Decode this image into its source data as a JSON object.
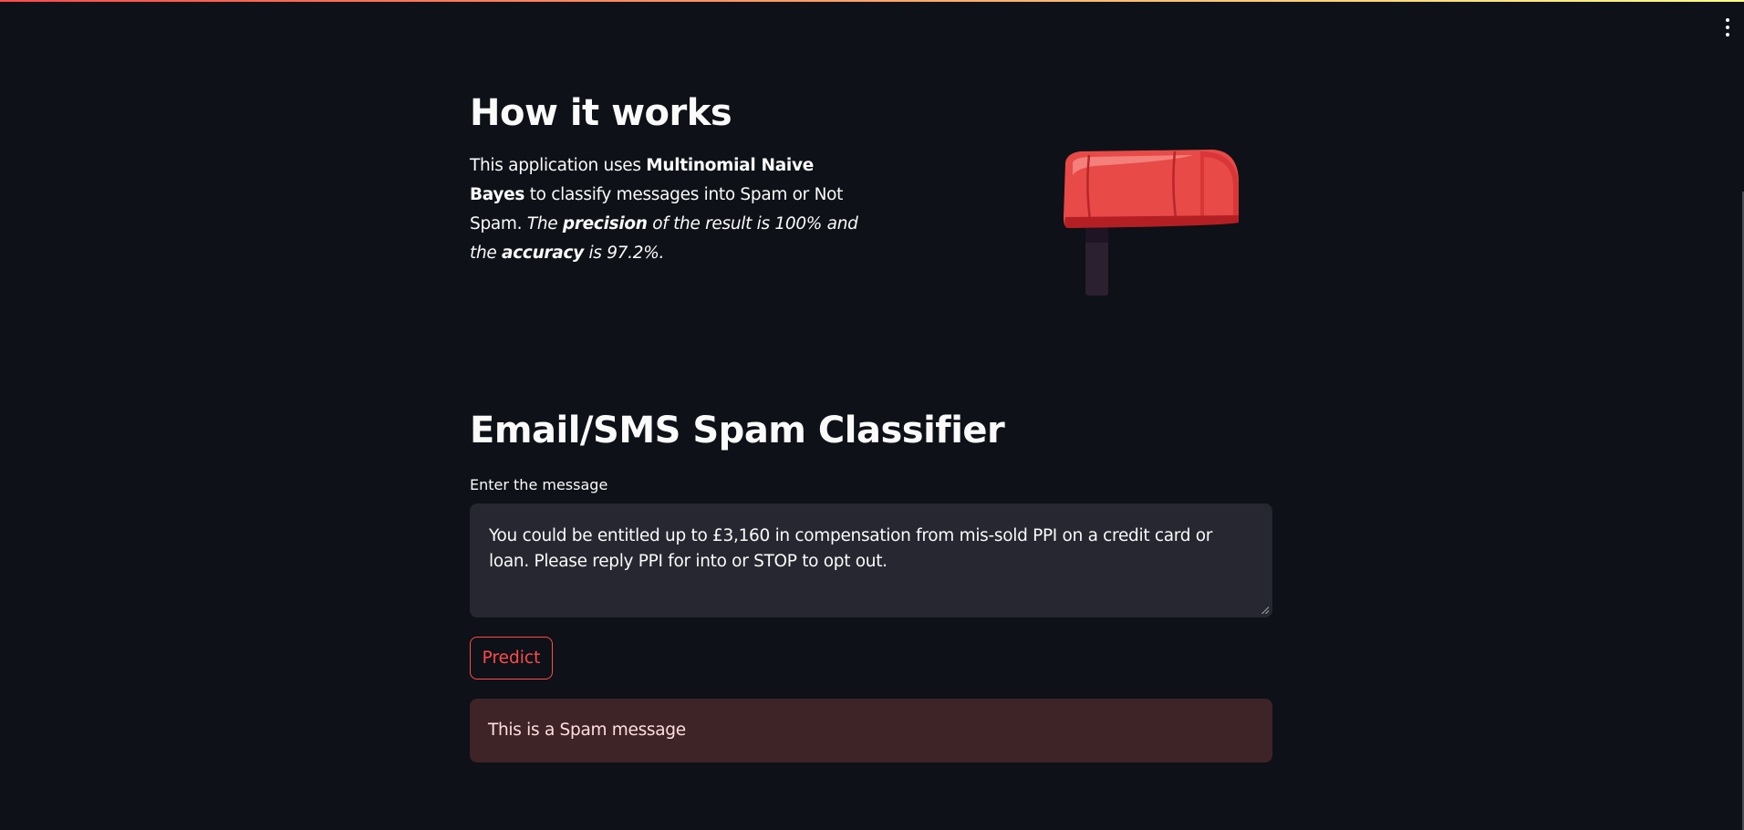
{
  "about": {
    "title": "How it works",
    "body": {
      "text1": "This application uses ",
      "bold1": "Multinomial Naive Bayes",
      "text2": " to classify messages into Spam or Not Spam. ",
      "italic1": "The ",
      "bold_italic1": "precision",
      "italic2": " of the result is 100% and the ",
      "bold_italic2": "accuracy",
      "italic3": " is 97.2%."
    },
    "image": "mailbox-illustration"
  },
  "classifier": {
    "title": "Email/SMS Spam Classifier",
    "input_label": "Enter the message",
    "input_value": "You could be entitled up to £3,160 in compensation from mis-sold PPI on a credit card or loan. Please reply PPI for into or STOP to opt out.",
    "button_label": "Predict",
    "result": "This is a Spam message"
  },
  "colors": {
    "background": "#0e1117",
    "accent": "#ff4b4b",
    "input_bg": "#262730",
    "error_bg": "#3e2327"
  },
  "icons": {
    "menu": "vertical-dots-menu-icon"
  }
}
